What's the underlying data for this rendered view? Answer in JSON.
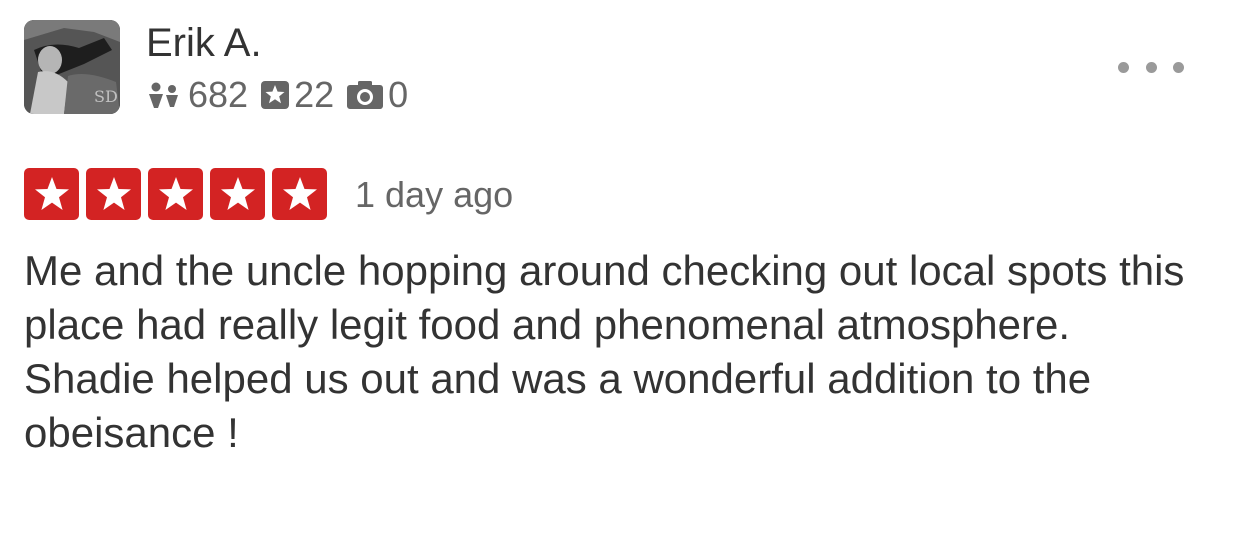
{
  "user": {
    "name": "Erik A.",
    "avatar_overlay_text": "SD",
    "friends_count": "682",
    "reviews_count": "22",
    "photos_count": "0"
  },
  "icons": {
    "friends": "friends-icon",
    "reviews": "star-badge-icon",
    "photos": "camera-icon",
    "more": "more-options-icon",
    "rating_star": "star-icon"
  },
  "review": {
    "rating": 5,
    "rating_max": 5,
    "date": "1 day ago",
    "paragraphs": [
      "Me and the uncle hopping around checking out local spots this place had really legit food and phenomenal atmosphere.",
      "Shadie helped us out and was a wonderful addition to the obeisance !"
    ]
  },
  "colors": {
    "star_red": "#d32323",
    "text_primary": "#333333",
    "text_secondary": "#666666"
  }
}
